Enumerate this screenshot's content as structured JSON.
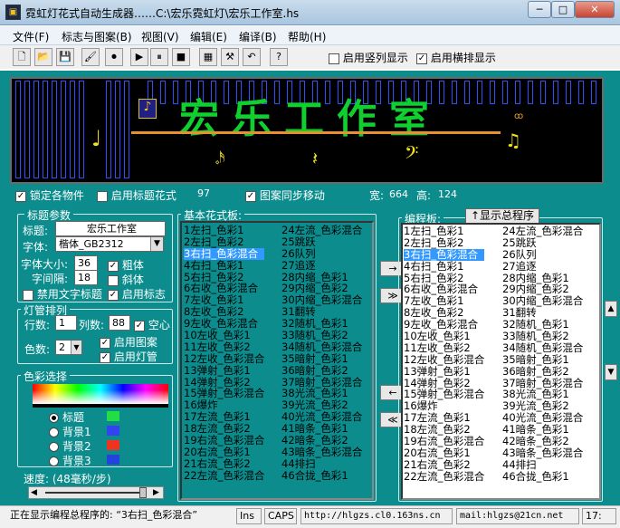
{
  "window": {
    "title": "霓虹灯花式自动生成器……C:\\宏乐霓虹灯\\宏乐工作室.hs",
    "minimize": "─",
    "maximize": "□",
    "close": "✕"
  },
  "menu": [
    "文件(F)",
    "标志与图案(B)",
    "视图(V)",
    "编辑(E)",
    "编译(B)",
    "帮助(H)"
  ],
  "toolbar": {
    "buttons": [
      "new-icon",
      "open-icon",
      "save-icon",
      "paint-icon",
      "stop-record-icon",
      "play-icon",
      "pause-icon",
      "stop-icon",
      "calc-icon",
      "tools-icon",
      "undo-icon",
      "help-icon"
    ],
    "glyphs": [
      "🗋",
      "📂",
      "💾",
      "🖌",
      "⏺",
      "▶",
      "⏸",
      "■",
      "▦",
      "⚒",
      "↶",
      "?"
    ],
    "show_vertical": "启用竖列显示",
    "show_horizontal": "启用横排显示"
  },
  "display": {
    "text": "宏乐工作室"
  },
  "options": {
    "lock": "锁定各物件",
    "title_style": "启用标题花式",
    "count": "97",
    "sync_move": "图案同步移动",
    "width_label": "宽:",
    "width": "664",
    "height_label": "高:",
    "height": "124"
  },
  "title_params": {
    "group": "标题参数",
    "title_label": "标题:",
    "title_value": "宏乐工作室",
    "font_label": "字体:",
    "font_value": "楷体_GB2312",
    "size_label": "字体大小:",
    "size_value": "36",
    "spacing_label": "字间隔:",
    "spacing_value": "18",
    "bold": "粗体",
    "italic": "斜体",
    "disable_text_title": "禁用文字标题",
    "enable_logo": "启用标志"
  },
  "lamp": {
    "group": "灯管排列",
    "rows_label": "行数:",
    "rows": "1",
    "cols_label": "列数:",
    "cols": "88",
    "hollow": "空心",
    "colors_label": "色数:",
    "colors": "2",
    "enable_pattern": "启用图案",
    "enable_lamp": "启用灯管"
  },
  "color_select": {
    "group": "色彩选择",
    "options": [
      {
        "label": "标题",
        "color": "#22dd44",
        "selected": true
      },
      {
        "label": "背景1",
        "color": "#3344ee",
        "selected": false
      },
      {
        "label": "背景2",
        "color": "#ee3322",
        "selected": false
      },
      {
        "label": "背景3",
        "color": "#2244dd",
        "selected": false
      }
    ]
  },
  "speed": {
    "label": "速度: (48毫秒/步)"
  },
  "basic_patterns": {
    "group": "基本花式板:",
    "col1": [
      "1左扫_色彩1",
      "2左扫_色彩2",
      "3右扫_色彩混合",
      "4右扫_色彩1",
      "5右扫_色彩2",
      "6右收_色彩混合",
      "7左收_色彩1",
      "8左收_色彩2",
      "9左收_色彩混合",
      "10左收_色彩1",
      "11左收_色彩2",
      "12左收_色彩混合",
      "13弹射_色彩1",
      "14弹射_色彩2",
      "15弹射_色彩混合",
      "16爆炸",
      "17左流_色彩1",
      "18左流_色彩2",
      "19右流_色彩混合",
      "20右流_色彩1",
      "21右流_色彩2",
      "22左流_色彩混合"
    ],
    "col2": [
      "24左流_色彩混合",
      "25跳跃",
      "26队列",
      "27追逐",
      "28内缩_色彩1",
      "29内缩_色彩2",
      "30内缩_色彩混合",
      "31翻转",
      "32随机_色彩1",
      "33随机_色彩2",
      "34随机_色彩混合",
      "35暗射_色彩1",
      "36暗射_色彩2",
      "37暗射_色彩混合",
      "38光流_色彩1",
      "39光流_色彩2",
      "40光流_色彩混合",
      "41暗条_色彩1",
      "42暗条_色彩2",
      "43暗条_色彩混合",
      "44排扫",
      "46合拢_色彩1"
    ],
    "selected_index": 2
  },
  "arrows": [
    "→",
    "≫",
    "←",
    "≪"
  ],
  "program": {
    "group": "编程板:",
    "show_button": "↑显示总程序",
    "col1": [
      "1左扫_色彩1",
      "2左扫_色彩2",
      "3右扫_色彩混合",
      "4右扫_色彩1",
      "5右扫_色彩2",
      "6右收_色彩混合",
      "7左收_色彩1",
      "8左收_色彩2",
      "9左收_色彩混合",
      "10左收_色彩1",
      "11左收_色彩2",
      "12左收_色彩混合",
      "13弹射_色彩1",
      "14弹射_色彩2",
      "15弹射_色彩混合",
      "16爆炸",
      "17左流_色彩1",
      "18左流_色彩2",
      "19右流_色彩混合",
      "20右流_色彩1",
      "21右流_色彩2",
      "22左流_色彩混合"
    ],
    "col2": [
      "24左流_色彩混合",
      "25跳跃",
      "26队列",
      "27追逐",
      "28内缩_色彩1",
      "29内缩_色彩2",
      "30内缩_色彩混合",
      "31翻转",
      "32随机_色彩1",
      "33随机_色彩2",
      "34随机_色彩混合",
      "35暗射_色彩1",
      "36暗射_色彩2",
      "37暗射_色彩混合",
      "38光流_色彩1",
      "39光流_色彩2",
      "40光流_色彩混合",
      "41暗条_色彩1",
      "42暗条_色彩2",
      "43暗条_色彩混合",
      "44排扫",
      "46合拢_色彩1"
    ],
    "selected_index": 2
  },
  "status": {
    "message": "正在显示编程总程序的: “3右扫_色彩混合”",
    "ins": "Ins",
    "caps": "CAPS",
    "url": "http://hlgzs.cl0.163ns.cn",
    "mail": "mail:hlgzs@21cn.net",
    "time": "17:"
  },
  "colors": {
    "teal": "#0c8c8c",
    "neon_green": "#10d030",
    "selection": "#3399ff"
  }
}
